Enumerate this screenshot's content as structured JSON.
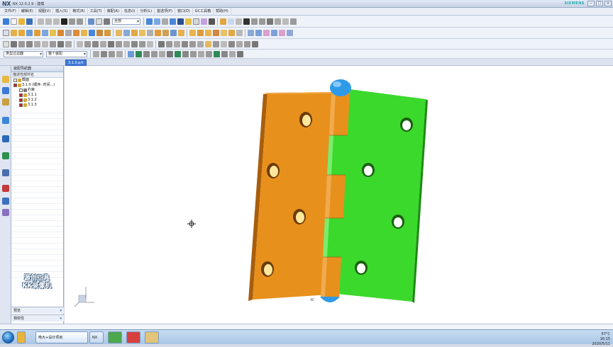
{
  "window": {
    "logo": "NX",
    "title": "NX 12.0.2.9  - 建模",
    "brand": "SIEMENS",
    "controls": [
      "−",
      "□",
      "×"
    ]
  },
  "menubar": {
    "items": [
      "文件(F)",
      "编辑(E)",
      "视图(V)",
      "插入(S)",
      "格式(R)",
      "工具(T)",
      "装配(A)",
      "信息(I)",
      "分析(L)",
      "首选项(P)",
      "窗口(O)",
      "GC工具箱",
      "帮助(H)"
    ]
  },
  "toolbar": {
    "selection_filter": "整个装配",
    "snap_mode": "没有选择过滤器",
    "search_field": "全部",
    "type_filter": "类型过滤器",
    "scope": "整个装配"
  },
  "navigator": {
    "header": "装配导航器",
    "column_header": "描述性部件名",
    "tree": [
      {
        "label": "截面",
        "level": 0,
        "checked": false,
        "icon_color": "#d4a73a"
      },
      {
        "label": "3.1.0 (顺序: 时间...)",
        "level": 0,
        "checked": true,
        "icon_color": "#d4a73a"
      },
      {
        "label": "约束",
        "level": 1,
        "checked": false,
        "icon_color": "#777777"
      },
      {
        "label": "3.1.1",
        "level": 1,
        "checked": true,
        "icon_color": "#d4a73a"
      },
      {
        "label": "3.1.2",
        "level": 1,
        "checked": true,
        "icon_color": "#d4a73a"
      },
      {
        "label": "3.1.3",
        "level": 1,
        "checked": true,
        "icon_color": "#d4a73a"
      }
    ],
    "watermark_line1": "源创工具",
    "watermark_line2": "KK录像机",
    "footer_preview": "预览",
    "footer_dependencies": "相依性"
  },
  "graphics": {
    "tab_label": "3.1.0.prt",
    "triad_label": "XC"
  },
  "colors": {
    "leaf_left": "#e8901c",
    "leaf_left_dark": "#a85e0c",
    "leaf_right": "#3bd92c",
    "leaf_right_dark": "#1e8a14",
    "pin_cap": "#2f9be8",
    "hole": "#ffe69a"
  },
  "taskbar": {
    "tasks": [
      "电大+设计项目",
      "NX 12"
    ],
    "time": "16:15",
    "date": "2020/5/11",
    "weather": "67°C"
  }
}
